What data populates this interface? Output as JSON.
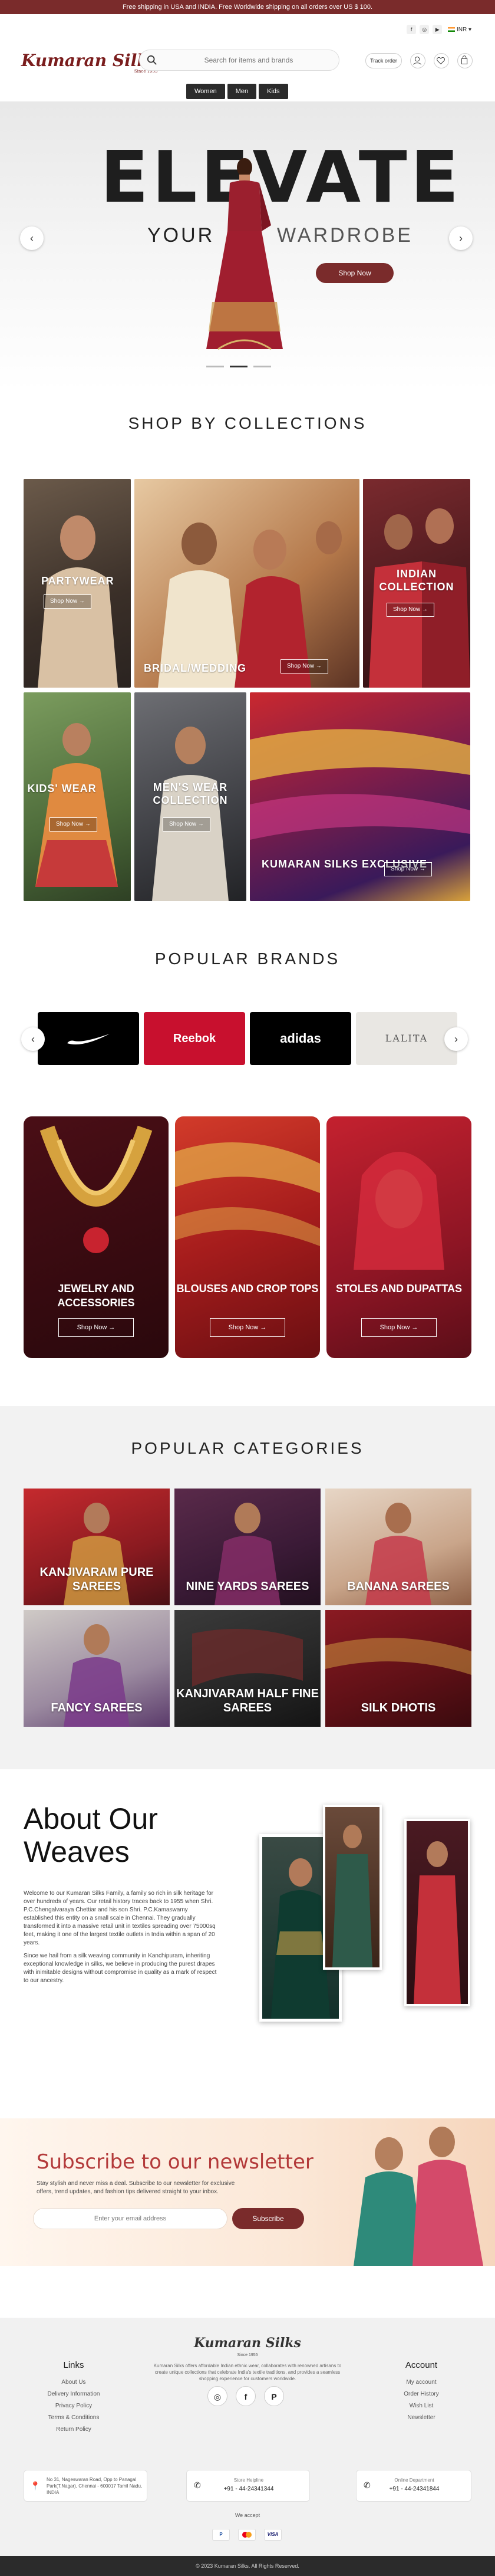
{
  "topbar": {
    "text": "Free shipping in USA and INDIA. Free Worldwide shipping on all orders over US $ 100."
  },
  "header": {
    "logo": "Kumaran Silks",
    "logo_tag": "Since 1955",
    "search_placeholder": "Search for items and brands",
    "track_label": "Track order",
    "currency": "INR",
    "nav": [
      "Women",
      "Men",
      "Kids"
    ],
    "social_icons": [
      "facebook-icon",
      "instagram-icon",
      "youtube-icon"
    ]
  },
  "hero": {
    "title": "ELEVATE",
    "line_left": "YOUR",
    "line_right": "WARDROBE",
    "button": "Shop Now",
    "slides": 3,
    "active_slide": 2
  },
  "collections": {
    "title": "SHOP BY COLLECTIONS",
    "items": [
      {
        "label": "PARTYWEAR",
        "button": "Shop Now"
      },
      {
        "label": "BRIDAL/WEDDING",
        "button": "Shop Now"
      },
      {
        "label": "INDIAN COLLECTION",
        "button": "Shop Now"
      },
      {
        "label": "KIDS' WEAR",
        "button": "Shop Now"
      },
      {
        "label": "MEN'S WEAR COLLECTION",
        "button": "Shop Now"
      },
      {
        "label": "KUMARAN SILKS EXCLUSIVE",
        "button": "Shop Now"
      }
    ]
  },
  "brands": {
    "title": "POPULAR BRANDS",
    "items": [
      "Nike",
      "Reebok",
      "adidas",
      "LALITA"
    ]
  },
  "accessories": [
    {
      "label": "JEWELRY AND ACCESSORIES",
      "button": "Shop Now"
    },
    {
      "label": "BLOUSES AND CROP TOPS",
      "button": "Shop Now"
    },
    {
      "label": "STOLES AND DUPATTAS",
      "button": "Shop Now"
    }
  ],
  "categories": {
    "title": "POPULAR CATEGORIES",
    "items": [
      "KANJIVARAM PURE SAREES",
      "NINE YARDS SAREES",
      "BANANA SAREES",
      "FANCY SAREES",
      "KANJIVARAM HALF FINE SAREES",
      "SILK DHOTIS"
    ]
  },
  "about": {
    "title_1": "About Our",
    "title_2": "Weaves",
    "para_1": "Welcome to our Kumaran Silks Family, a family so rich in silk heritage for over hundreds of years. Our retail history traces back to 1955 when Shri. P.C.Chengalvaraya Chettiar and his son Shri. P.C.Kamaswamy established this entity on a small scale in Chennai. They gradually transformed it into a massive retail unit in textiles spreading over 75000sq feet, making it one of the largest textile outlets in India within a span of 20 years.",
    "para_2": "Since we hail from a silk weaving community in Kanchipuram, inheriting exceptional knowledge in silks, we believe in producing the purest drapes with inimitable designs without compromise in quality as a mark of respect to our ancestry."
  },
  "newsletter": {
    "title": "Subscribe to our newsletter",
    "text": "Stay stylish and never miss a deal. Subscribe to our newsletter for exclusive offers, trend updates, and fashion tips delivered straight to your inbox.",
    "placeholder": "Enter your email address",
    "button": "Subscribe"
  },
  "footer": {
    "logo": "Kumaran Silks",
    "logo_tag": "Since 1955",
    "tagline": "Kumaran Silks offers affordable Indian ethnic wear, collaborates with renowned artisans to create unique collections that celebrate India's textile traditions, and provides a seamless shopping experience for customers worldwide.",
    "links_title": "Links",
    "links": [
      "About Us",
      "Delivery Information",
      "Privacy Policy",
      "Terms & Conditions",
      "Return Policy"
    ],
    "account_title": "Account",
    "account": [
      "My account",
      "Order History",
      "Wish List",
      "Newsletter"
    ],
    "address": "No 31, Nageswaran Road, Opp to Panagal Park(T.Nagar), Chennai - 600017 Tamil Nadu, INDIA",
    "phone_label": "Store Helpline",
    "phone": "+91 - 44-24341344",
    "online_label": "Online Department",
    "online": "+91 - 44-24341844",
    "accept_label": "We accept",
    "payments": [
      "PayPal",
      "Mastercard",
      "VISA"
    ],
    "copyright": "© 2023 Kumaran Silks. All Rights Reserved."
  }
}
